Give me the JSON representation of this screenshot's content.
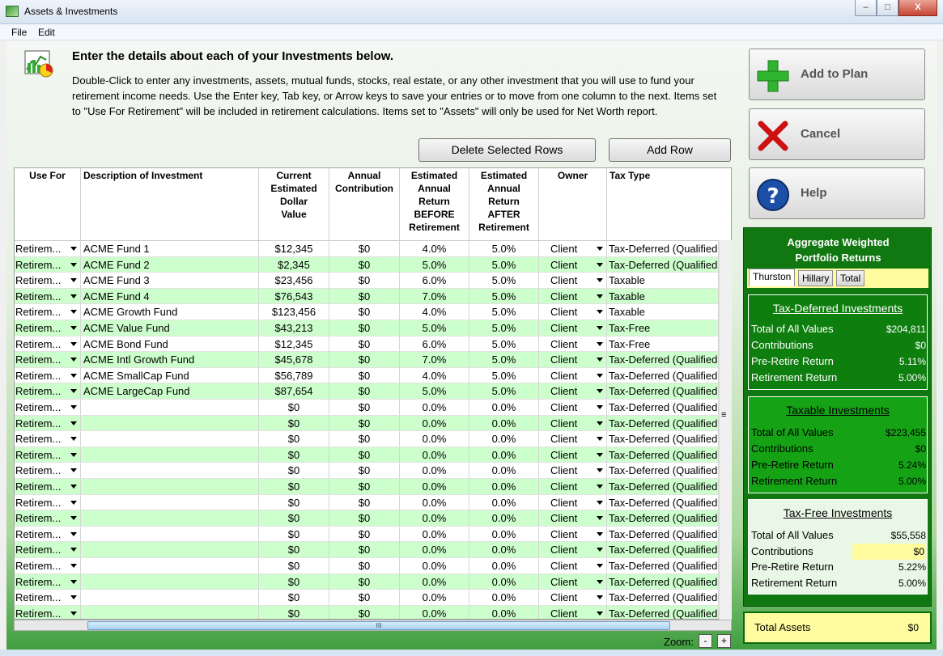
{
  "window": {
    "title": "Assets & Investments",
    "min": "–",
    "max": "□",
    "close": "X"
  },
  "menu": [
    "File",
    "Edit"
  ],
  "heading": "Enter the details about each of your Investments below.",
  "description": "Double-Click to enter any investments, assets, mutual funds, stocks, real estate, or any other investment that you will use to fund your retirement income needs.  Use the Enter key, Tab key, or Arrow keys to save your entries or to move from one column to the next. Items set to \"Use For Retirement\" will be included in retirement calculations. Items set to \"Assets\" will only be used for Net Worth report.",
  "buttons": {
    "delete_rows": "Delete Selected Rows",
    "add_row": "Add Row",
    "add_to_plan": "Add to Plan",
    "cancel": "Cancel",
    "help": "Help"
  },
  "columns": [
    {
      "label": "Use For"
    },
    {
      "label": "Description of Investment"
    },
    {
      "label": "Current Estimated Dollar Value"
    },
    {
      "label": "Annual Contribution"
    },
    {
      "label": "Estimated Annual Return BEFORE Retirement"
    },
    {
      "label": "Estimated Annual Return AFTER Retirement"
    },
    {
      "label": "Owner"
    },
    {
      "label": "Tax Type"
    }
  ],
  "rows": [
    [
      "Retirem...",
      "ACME Fund 1",
      "$12,345",
      "$0",
      "4.0%",
      "5.0%",
      "Client",
      "Tax-Deferred (Qualified"
    ],
    [
      "Retirem...",
      "ACME Fund 2",
      "$2,345",
      "$0",
      "5.0%",
      "5.0%",
      "Client",
      "Tax-Deferred (Qualified"
    ],
    [
      "Retirem...",
      "ACME Fund 3",
      "$23,456",
      "$0",
      "6.0%",
      "5.0%",
      "Client",
      "Taxable"
    ],
    [
      "Retirem...",
      "ACME Fund 4",
      "$76,543",
      "$0",
      "7.0%",
      "5.0%",
      "Client",
      "Taxable"
    ],
    [
      "Retirem...",
      "ACME Growth Fund",
      "$123,456",
      "$0",
      "4.0%",
      "5.0%",
      "Client",
      "Taxable"
    ],
    [
      "Retirem...",
      "ACME Value Fund",
      "$43,213",
      "$0",
      "5.0%",
      "5.0%",
      "Client",
      "Tax-Free"
    ],
    [
      "Retirem...",
      "ACME Bond Fund",
      "$12,345",
      "$0",
      "6.0%",
      "5.0%",
      "Client",
      "Tax-Free"
    ],
    [
      "Retirem...",
      "ACME Intl Growth Fund",
      "$45,678",
      "$0",
      "7.0%",
      "5.0%",
      "Client",
      "Tax-Deferred (Qualified"
    ],
    [
      "Retirem...",
      "ACME SmallCap Fund",
      "$56,789",
      "$0",
      "4.0%",
      "5.0%",
      "Client",
      "Tax-Deferred (Qualified"
    ],
    [
      "Retirem...",
      "ACME LargeCap Fund",
      "$87,654",
      "$0",
      "5.0%",
      "5.0%",
      "Client",
      "Tax-Deferred (Qualified"
    ],
    [
      "Retirem...",
      "",
      "$0",
      "$0",
      "0.0%",
      "0.0%",
      "Client",
      "Tax-Deferred (Qualified"
    ],
    [
      "Retirem...",
      "",
      "$0",
      "$0",
      "0.0%",
      "0.0%",
      "Client",
      "Tax-Deferred (Qualified"
    ],
    [
      "Retirem...",
      "",
      "$0",
      "$0",
      "0.0%",
      "0.0%",
      "Client",
      "Tax-Deferred (Qualified"
    ],
    [
      "Retirem...",
      "",
      "$0",
      "$0",
      "0.0%",
      "0.0%",
      "Client",
      "Tax-Deferred (Qualified"
    ],
    [
      "Retirem...",
      "",
      "$0",
      "$0",
      "0.0%",
      "0.0%",
      "Client",
      "Tax-Deferred (Qualified"
    ],
    [
      "Retirem...",
      "",
      "$0",
      "$0",
      "0.0%",
      "0.0%",
      "Client",
      "Tax-Deferred (Qualified"
    ],
    [
      "Retirem...",
      "",
      "$0",
      "$0",
      "0.0%",
      "0.0%",
      "Client",
      "Tax-Deferred (Qualified"
    ],
    [
      "Retirem...",
      "",
      "$0",
      "$0",
      "0.0%",
      "0.0%",
      "Client",
      "Tax-Deferred (Qualified"
    ],
    [
      "Retirem...",
      "",
      "$0",
      "$0",
      "0.0%",
      "0.0%",
      "Client",
      "Tax-Deferred (Qualified"
    ],
    [
      "Retirem...",
      "",
      "$0",
      "$0",
      "0.0%",
      "0.0%",
      "Client",
      "Tax-Deferred (Qualified"
    ],
    [
      "Retirem...",
      "",
      "$0",
      "$0",
      "0.0%",
      "0.0%",
      "Client",
      "Tax-Deferred (Qualified"
    ],
    [
      "Retirem...",
      "",
      "$0",
      "$0",
      "0.0%",
      "0.0%",
      "Client",
      "Tax-Deferred (Qualified"
    ],
    [
      "Retirem...",
      "",
      "$0",
      "$0",
      "0.0%",
      "0.0%",
      "Client",
      "Tax-Deferred (Qualified"
    ],
    [
      "Retirem...",
      "",
      "$0",
      "$0",
      "0.0%",
      "0.0%",
      "Client",
      "Tax-Deferred (Qualified"
    ]
  ],
  "zoom": {
    "label": "Zoom:",
    "minus": "-",
    "plus": "+"
  },
  "scroll_grip": "III",
  "scroll_grip_v": "≡",
  "panel": {
    "title": "Aggregate Weighted Portfolio Returns",
    "tabs": [
      "Thurston",
      "Hillary",
      "Total"
    ],
    "sections": [
      {
        "title": "Tax-Deferred Investments",
        "lines": [
          {
            "label": "Total of All Values",
            "value": "$204,811"
          },
          {
            "label": "Contributions",
            "value": "$0"
          },
          {
            "label": "Pre-Retire Return",
            "value": "5.11%"
          },
          {
            "label": "Retirement Return",
            "value": "5.00%"
          }
        ]
      },
      {
        "title": "Taxable Investments",
        "lines": [
          {
            "label": "Total of All Values",
            "value": "$223,455"
          },
          {
            "label": "Contributions",
            "value": "$0"
          },
          {
            "label": "Pre-Retire Return",
            "value": "5.24%"
          },
          {
            "label": "Retirement Return",
            "value": "5.00%"
          }
        ]
      },
      {
        "title": "Tax-Free Investments",
        "lines": [
          {
            "label": "Total of All Values",
            "value": "$55,558"
          },
          {
            "label": "Contributions",
            "value": "$0"
          },
          {
            "label": "Pre-Retire Return",
            "value": "5.22%"
          },
          {
            "label": "Retirement Return",
            "value": "5.00%"
          }
        ]
      }
    ],
    "total_assets": {
      "label": "Total Assets",
      "value": "$0"
    }
  }
}
